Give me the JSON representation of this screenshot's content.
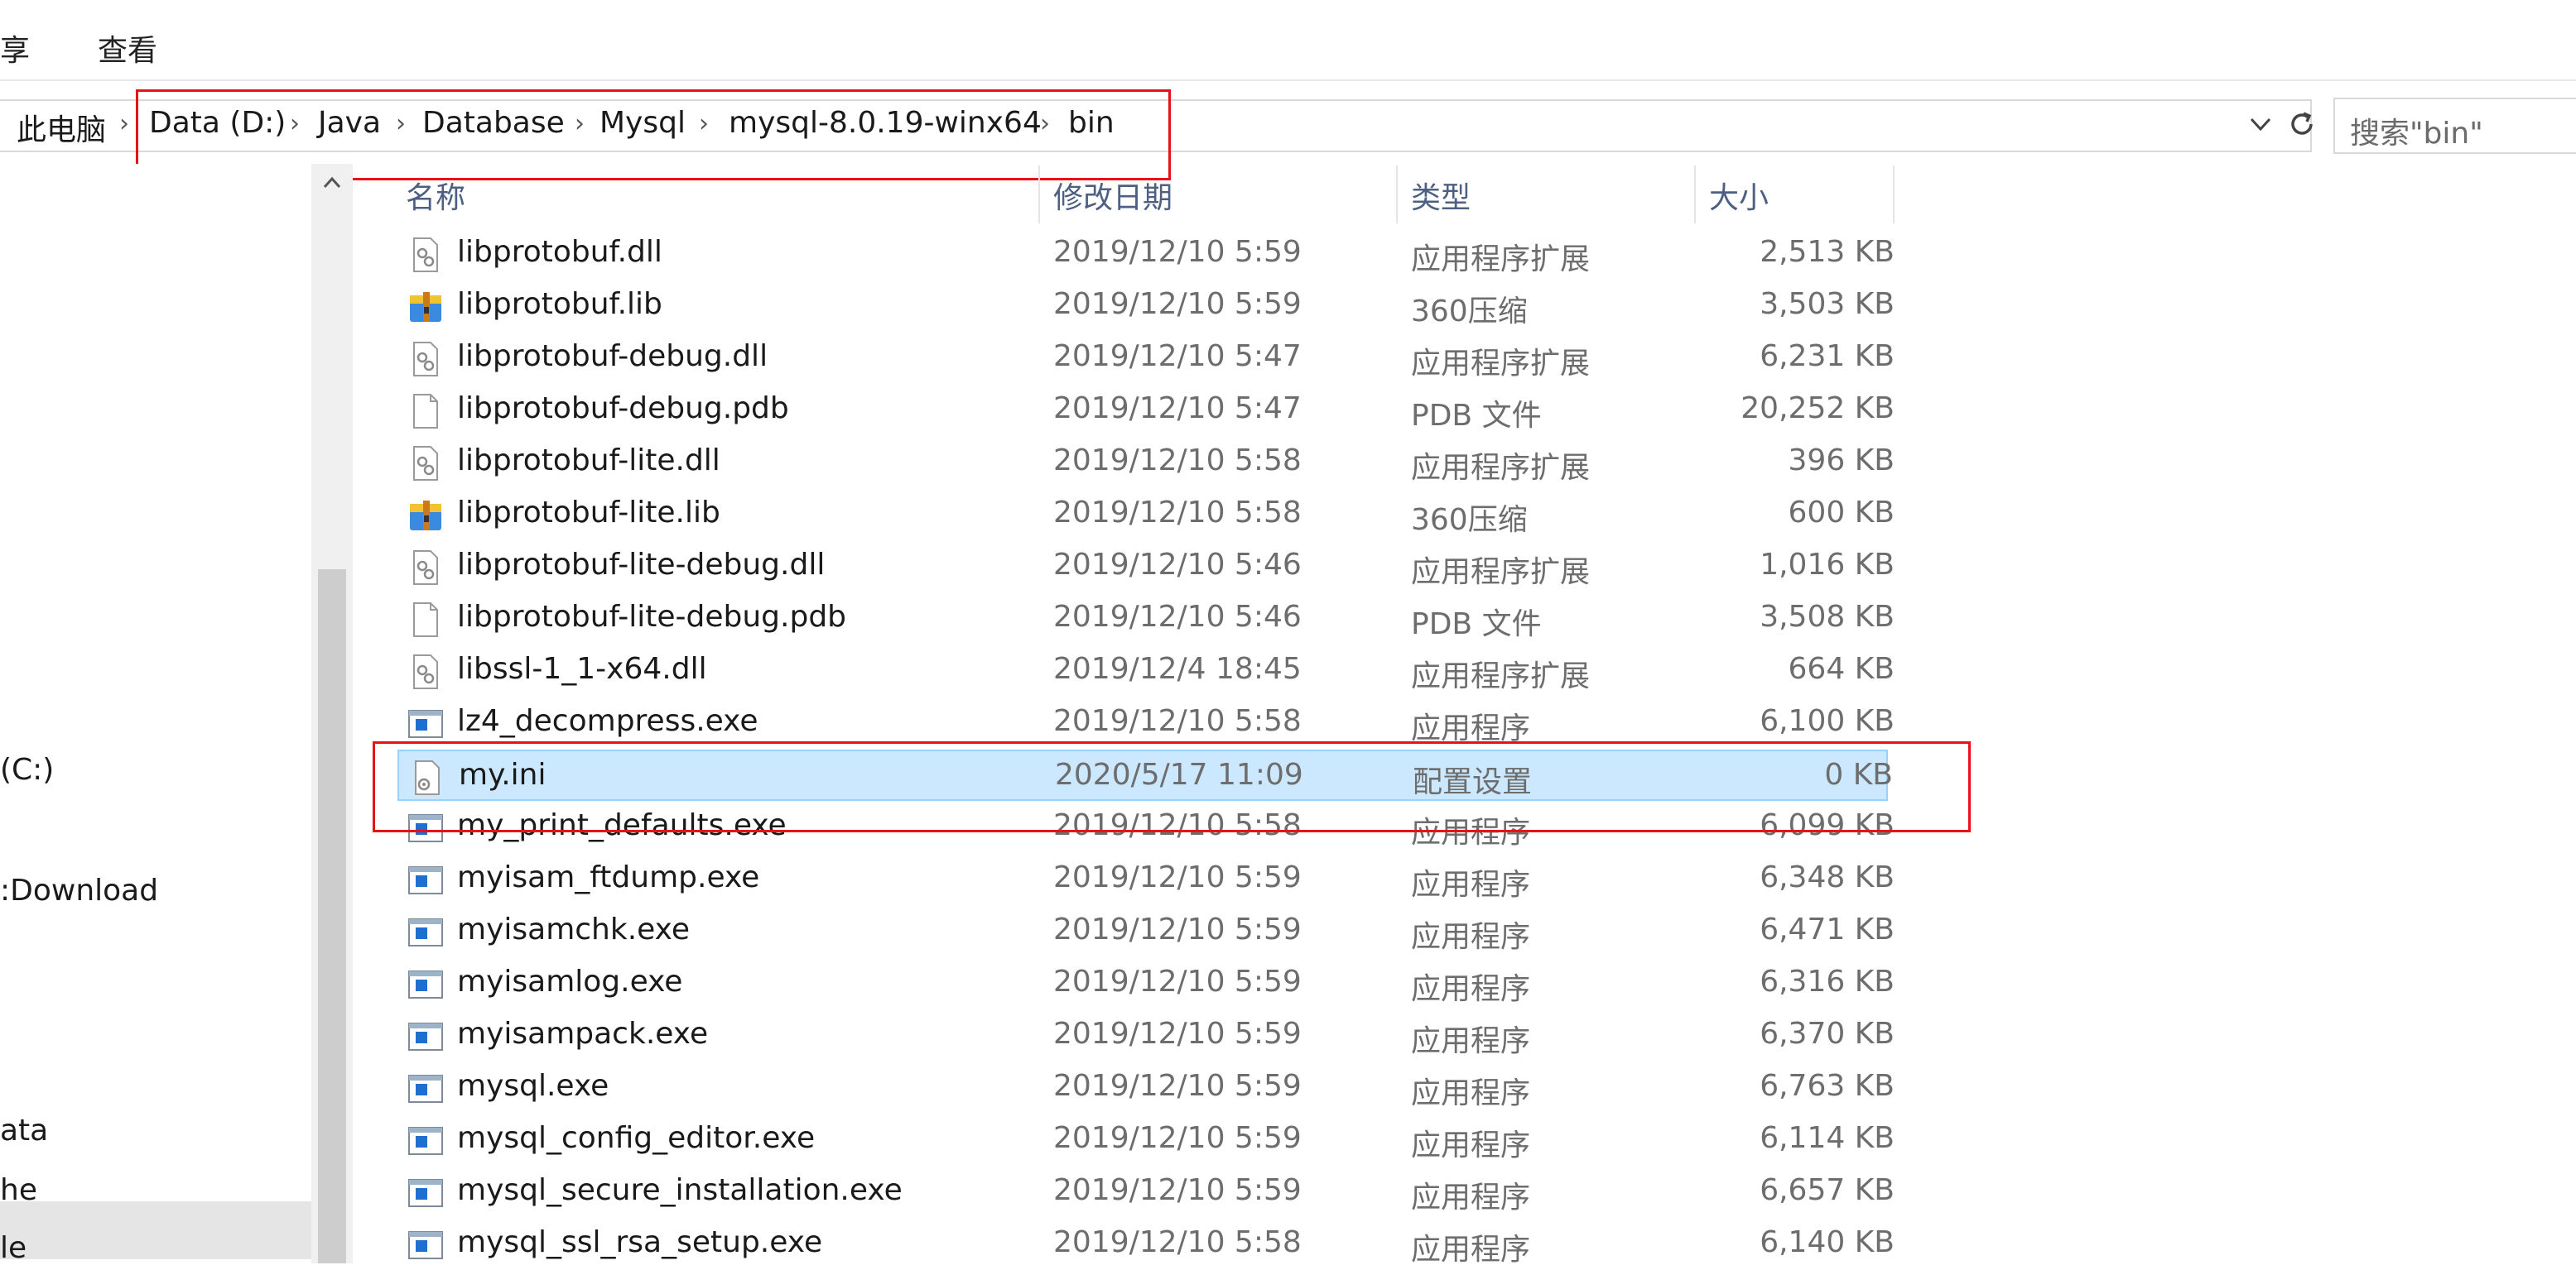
{
  "ribbon": {
    "tabs": [
      "享",
      "查看"
    ]
  },
  "address": {
    "crumbs": [
      "此电脑",
      "Data (D:)",
      "Java",
      "Database",
      "Mysql",
      "mysql-8.0.19-winx64",
      "bin"
    ],
    "search_placeholder": "搜索\"bin\""
  },
  "nav": {
    "items": [
      "(C:)",
      ":Download",
      "ata",
      "he",
      "le"
    ]
  },
  "columns": {
    "name": "名称",
    "date": "修改日期",
    "type": "类型",
    "size": "大小"
  },
  "files": [
    {
      "name": "libprotobuf.dll",
      "date": "2019/12/10 5:59",
      "type": "应用程序扩展",
      "size": "2,513 KB",
      "icon": "dll-icon"
    },
    {
      "name": "libprotobuf.lib",
      "date": "2019/12/10 5:59",
      "type": "360压缩",
      "size": "3,503 KB",
      "icon": "archive-icon"
    },
    {
      "name": "libprotobuf-debug.dll",
      "date": "2019/12/10 5:47",
      "type": "应用程序扩展",
      "size": "6,231 KB",
      "icon": "dll-icon"
    },
    {
      "name": "libprotobuf-debug.pdb",
      "date": "2019/12/10 5:47",
      "type": "PDB 文件",
      "size": "20,252 KB",
      "icon": "file-icon"
    },
    {
      "name": "libprotobuf-lite.dll",
      "date": "2019/12/10 5:58",
      "type": "应用程序扩展",
      "size": "396 KB",
      "icon": "dll-icon"
    },
    {
      "name": "libprotobuf-lite.lib",
      "date": "2019/12/10 5:58",
      "type": "360压缩",
      "size": "600 KB",
      "icon": "archive-icon"
    },
    {
      "name": "libprotobuf-lite-debug.dll",
      "date": "2019/12/10 5:46",
      "type": "应用程序扩展",
      "size": "1,016 KB",
      "icon": "dll-icon"
    },
    {
      "name": "libprotobuf-lite-debug.pdb",
      "date": "2019/12/10 5:46",
      "type": "PDB 文件",
      "size": "3,508 KB",
      "icon": "file-icon"
    },
    {
      "name": "libssl-1_1-x64.dll",
      "date": "2019/12/4 18:45",
      "type": "应用程序扩展",
      "size": "664 KB",
      "icon": "dll-icon"
    },
    {
      "name": "lz4_decompress.exe",
      "date": "2019/12/10 5:58",
      "type": "应用程序",
      "size": "6,100 KB",
      "icon": "exe-icon"
    },
    {
      "name": "my.ini",
      "date": "2020/5/17 11:09",
      "type": "配置设置",
      "size": "0 KB",
      "icon": "ini-icon"
    },
    {
      "name": "my_print_defaults.exe",
      "date": "2019/12/10 5:58",
      "type": "应用程序",
      "size": "6,099 KB",
      "icon": "exe-icon"
    },
    {
      "name": "myisam_ftdump.exe",
      "date": "2019/12/10 5:59",
      "type": "应用程序",
      "size": "6,348 KB",
      "icon": "exe-icon"
    },
    {
      "name": "myisamchk.exe",
      "date": "2019/12/10 5:59",
      "type": "应用程序",
      "size": "6,471 KB",
      "icon": "exe-icon"
    },
    {
      "name": "myisamlog.exe",
      "date": "2019/12/10 5:59",
      "type": "应用程序",
      "size": "6,316 KB",
      "icon": "exe-icon"
    },
    {
      "name": "myisampack.exe",
      "date": "2019/12/10 5:59",
      "type": "应用程序",
      "size": "6,370 KB",
      "icon": "exe-icon"
    },
    {
      "name": "mysql.exe",
      "date": "2019/12/10 5:59",
      "type": "应用程序",
      "size": "6,763 KB",
      "icon": "exe-icon"
    },
    {
      "name": "mysql_config_editor.exe",
      "date": "2019/12/10 5:59",
      "type": "应用程序",
      "size": "6,114 KB",
      "icon": "exe-icon"
    },
    {
      "name": "mysql_secure_installation.exe",
      "date": "2019/12/10 5:59",
      "type": "应用程序",
      "size": "6,657 KB",
      "icon": "exe-icon"
    },
    {
      "name": "mysql_ssl_rsa_setup.exe",
      "date": "2019/12/10 5:58",
      "type": "应用程序",
      "size": "6,140 KB",
      "icon": "exe-icon"
    }
  ],
  "selected_file": "my.ini",
  "colors": {
    "selection_bg": "#cce8ff",
    "selection_border": "#99d1ff",
    "annotation_red": "#e8111a",
    "header_text": "#4d6082"
  }
}
